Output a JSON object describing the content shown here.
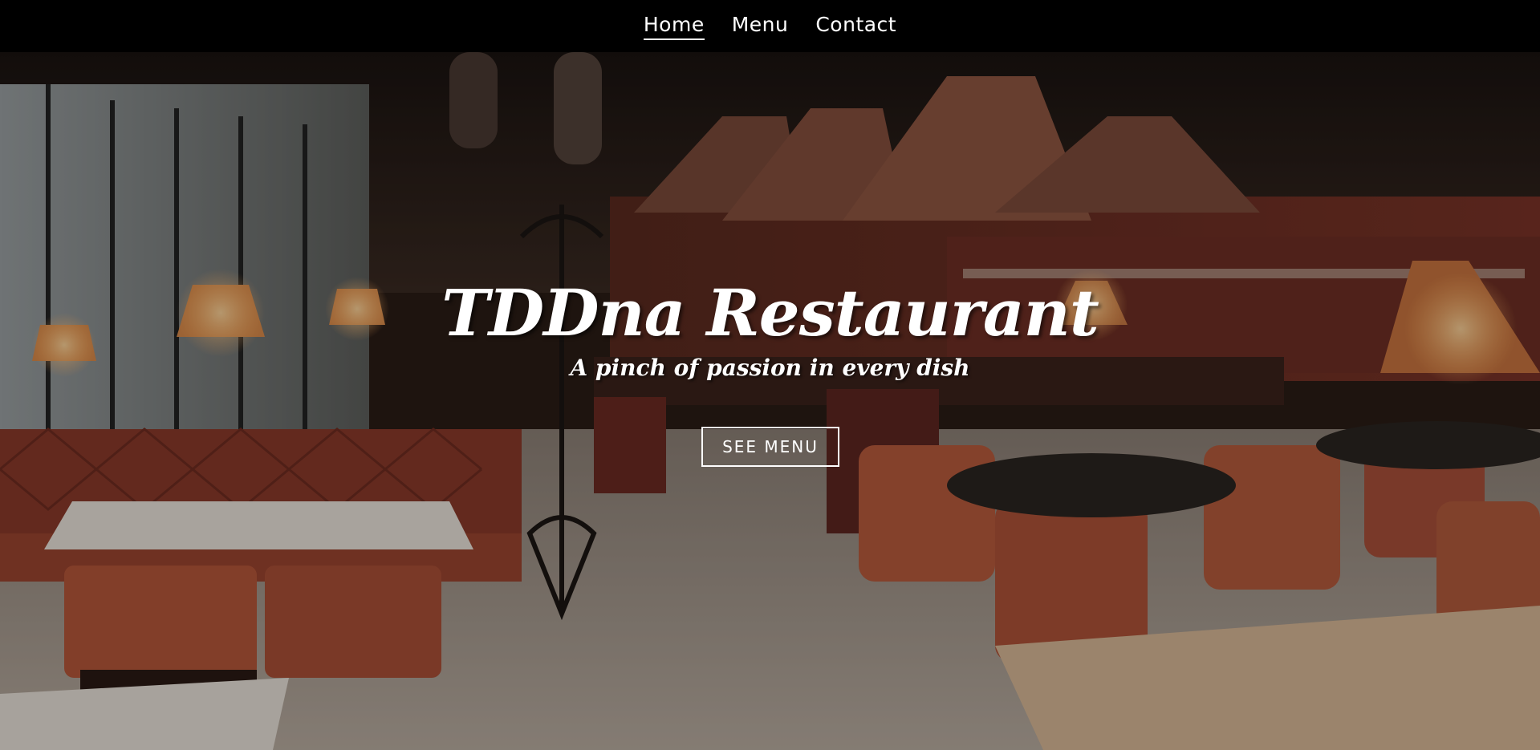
{
  "nav": {
    "items": [
      {
        "label": "Home",
        "active": true
      },
      {
        "label": "Menu",
        "active": false
      },
      {
        "label": "Contact",
        "active": false
      }
    ]
  },
  "hero": {
    "title": "TDDna Restaurant",
    "subtitle": "A pinch of passion in every dish",
    "button_label": "SEE MENU",
    "background_image": "restaurant-interior-photo"
  },
  "colors": {
    "nav_background": "#000000",
    "text": "#ffffff",
    "accent_wall": "#8a2f22",
    "chairs": "#b5563a"
  }
}
